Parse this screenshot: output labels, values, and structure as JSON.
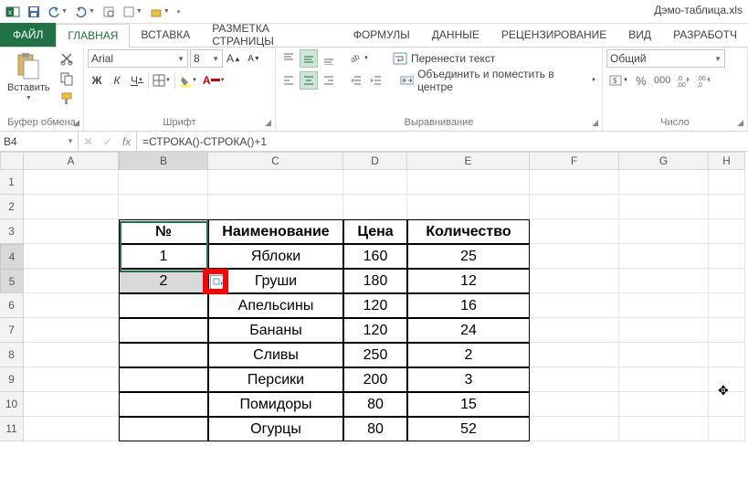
{
  "window_title": "Дэмо-таблица.xls",
  "qat": {
    "items": [
      "save",
      "undo",
      "redo",
      "preview",
      "new",
      "open"
    ]
  },
  "ribbon": {
    "file": "ФАЙЛ",
    "tabs": [
      "ГЛАВНАЯ",
      "ВСТАВКА",
      "РАЗМЕТКА СТРАНИЦЫ",
      "ФОРМУЛЫ",
      "ДАННЫЕ",
      "РЕЦЕНЗИРОВАНИЕ",
      "ВИД",
      "РАЗРАБОТЧ"
    ],
    "active_tab": "ГЛАВНАЯ",
    "clipboard": {
      "paste": "Вставить",
      "label": "Буфер обмена"
    },
    "font": {
      "name": "Arial",
      "size": "8",
      "bold": "Ж",
      "italic": "К",
      "underline": "Ч",
      "label": "Шрифт"
    },
    "alignment": {
      "wrap": "Перенести текст",
      "merge": "Объединить и поместить в центре",
      "label": "Выравнивание"
    },
    "number": {
      "format": "Общий",
      "label": "Число"
    }
  },
  "formula_bar": {
    "name_box": "B4",
    "formula": "=СТРОКА()-СТРОКА()+1"
  },
  "columns": [
    "A",
    "B",
    "C",
    "D",
    "E",
    "F",
    "G",
    "H"
  ],
  "rows": [
    "1",
    "2",
    "3",
    "4",
    "5",
    "6",
    "7",
    "8",
    "9",
    "10",
    "11"
  ],
  "table": {
    "headers": {
      "num": "№",
      "name": "Наименование",
      "price": "Цена",
      "qty": "Количество"
    },
    "rows": [
      {
        "num": "1",
        "name": "Яблоки",
        "price": "160",
        "qty": "25"
      },
      {
        "num": "2",
        "name": "Груши",
        "price": "180",
        "qty": "12"
      },
      {
        "num": "",
        "name": "Апельсины",
        "price": "120",
        "qty": "16"
      },
      {
        "num": "",
        "name": "Бананы",
        "price": "120",
        "qty": "24"
      },
      {
        "num": "",
        "name": "Сливы",
        "price": "250",
        "qty": "2"
      },
      {
        "num": "",
        "name": "Персики",
        "price": "200",
        "qty": "3"
      },
      {
        "num": "",
        "name": "Помидоры",
        "price": "80",
        "qty": "15"
      },
      {
        "num": "",
        "name": "Огурцы",
        "price": "80",
        "qty": "52"
      }
    ]
  },
  "chart_data": {
    "type": "table",
    "title": "",
    "columns": [
      "№",
      "Наименование",
      "Цена",
      "Количество"
    ],
    "rows": [
      [
        1,
        "Яблоки",
        160,
        25
      ],
      [
        2,
        "Груши",
        180,
        12
      ],
      [
        null,
        "Апельсины",
        120,
        16
      ],
      [
        null,
        "Бананы",
        120,
        24
      ],
      [
        null,
        "Сливы",
        250,
        2
      ],
      [
        null,
        "Персики",
        200,
        3
      ],
      [
        null,
        "Помидоры",
        80,
        15
      ],
      [
        null,
        "Огурцы",
        80,
        52
      ]
    ]
  },
  "colors": {
    "accent": "#217346",
    "marker": "#ff0000"
  }
}
